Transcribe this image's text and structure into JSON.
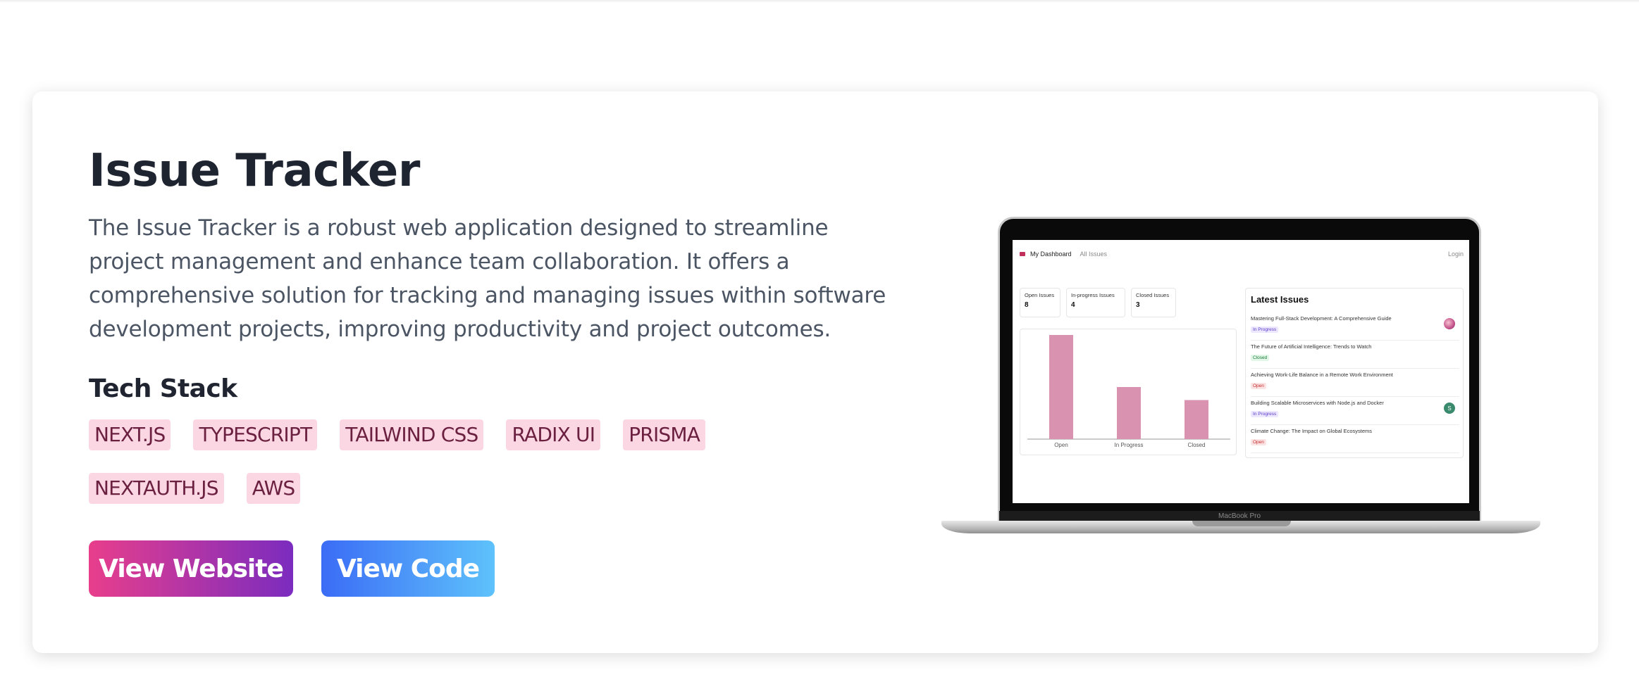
{
  "project": {
    "title": "Issue Tracker",
    "description": "The Issue Tracker is a robust web application designed to streamline project management and enhance team collaboration. It offers a comprehensive solution for tracking and managing issues within software development projects, improving productivity and project outcomes.",
    "tech_stack_heading": "Tech Stack",
    "tech_stack": [
      "NEXT.JS",
      "TYPESCRIPT",
      "TAILWIND CSS",
      "RADIX UI",
      "PRISMA",
      "NEXTAUTH.JS",
      "AWS"
    ],
    "buttons": {
      "website": "View Website",
      "code": "View Code"
    }
  },
  "colors": {
    "tag_bg": "#fbd7e4",
    "tag_text": "#6b2040",
    "website_gradient": [
      "#e83e8c",
      "#7b2cbf"
    ],
    "code_gradient": [
      "#3b6cf6",
      "#5ec2fb"
    ],
    "bar_color": "#d993b1"
  },
  "screenshot": {
    "device_brand": "MacBook Pro",
    "nav": {
      "dashboard": "My Dashboard",
      "issues": "All Issues",
      "login": "Login"
    },
    "stats": [
      {
        "label": "Open Issues",
        "value": "8"
      },
      {
        "label": "In-progress Issues",
        "value": "4"
      },
      {
        "label": "Closed Issues",
        "value": "3"
      }
    ],
    "latest_title": "Latest Issues",
    "latest_issues": [
      {
        "title": "Mastering Full-Stack Development: A Comprehensive Guide",
        "status": "In Progress",
        "status_key": "progress",
        "avatar": "pic"
      },
      {
        "title": "The Future of Artificial Intelligence: Trends to Watch",
        "status": "Closed",
        "status_key": "closed",
        "avatar": ""
      },
      {
        "title": "Achieving Work-Life Balance in a Remote Work Environment",
        "status": "Open",
        "status_key": "open",
        "avatar": ""
      },
      {
        "title": "Building Scalable Microservices with Node.js and Docker",
        "status": "In Progress",
        "status_key": "progress",
        "avatar": "S"
      },
      {
        "title": "Climate Change: The Impact on Global Ecosystems",
        "status": "Open",
        "status_key": "open",
        "avatar": ""
      }
    ],
    "chart_data": {
      "type": "bar",
      "categories": [
        "Open",
        "In Progress",
        "Closed"
      ],
      "values": [
        8,
        4,
        3
      ],
      "title": "",
      "xlabel": "",
      "ylabel": "",
      "ylim": [
        0,
        8
      ]
    }
  }
}
